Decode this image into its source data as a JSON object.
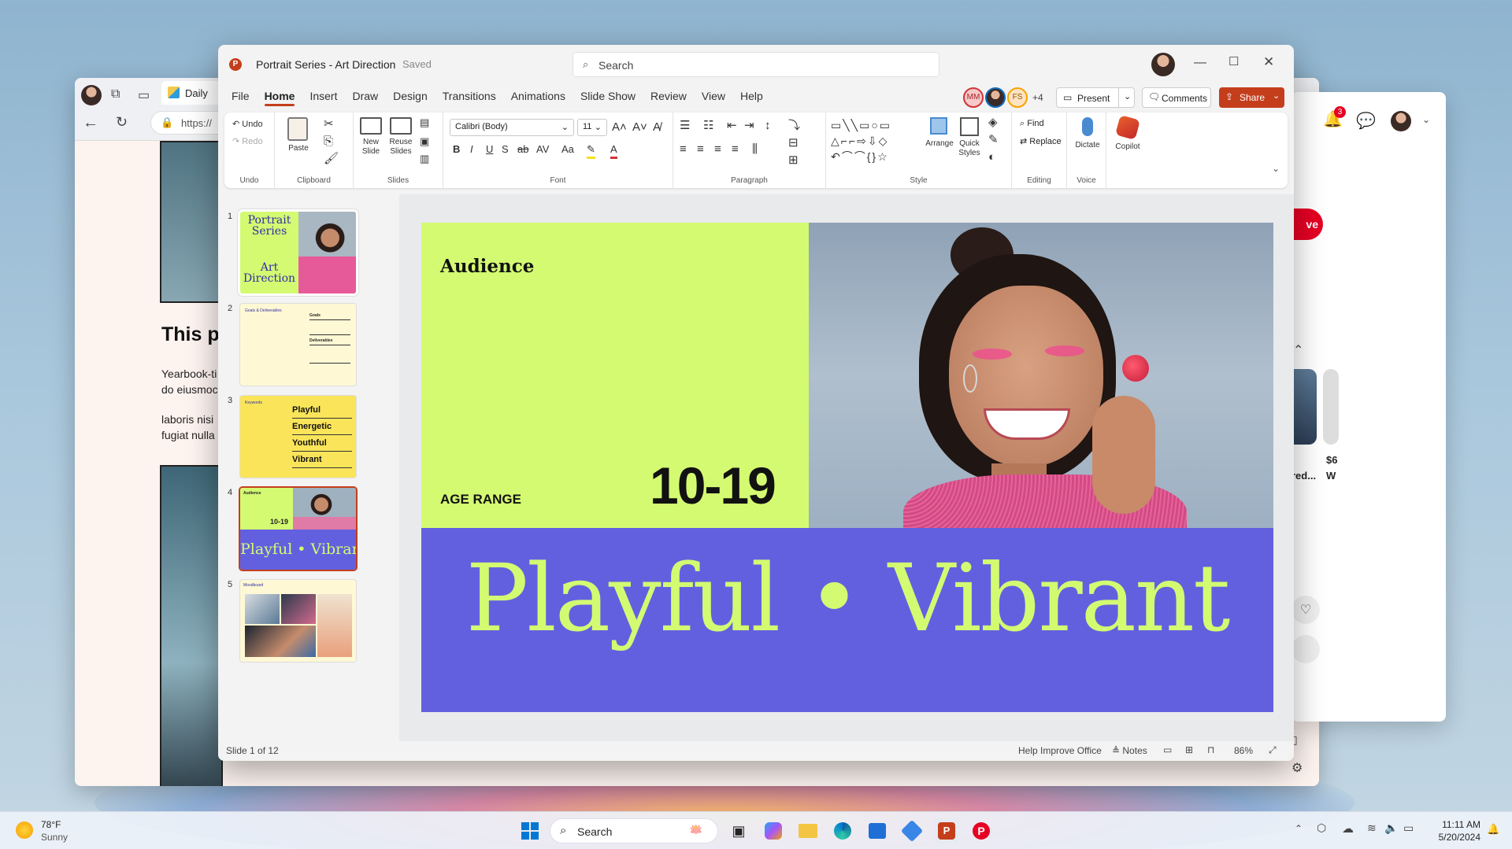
{
  "edge": {
    "tab_title": "Daily",
    "url": "https://",
    "heading": "This p",
    "para1_line1": "Yearbook-ti",
    "para1_line2": "do eiusmoc",
    "para2_line1": "laboris nisi",
    "para2_line2": "fugiat nulla"
  },
  "pinterest": {
    "save_label": "ve",
    "notif_count": "3",
    "price": "$6",
    "caption1": "red...",
    "caption2": "W"
  },
  "ppt": {
    "title": "Portrait Series - Art Direction",
    "saved": "Saved",
    "search_placeholder": "Search",
    "menu": [
      "File",
      "Home",
      "Insert",
      "Draw",
      "Design",
      "Transitions",
      "Animations",
      "Slide Show",
      "Review",
      "View",
      "Help"
    ],
    "collab": {
      "initials1": "MM",
      "initials3": "FS",
      "more": "+4"
    },
    "present": "Present",
    "comments": "Comments",
    "share": "Share",
    "ribbon": {
      "undo": "Undo",
      "redo": "Redo",
      "undo_group": "Undo",
      "paste": "Paste",
      "clipboard_group": "Clipboard",
      "new_slide": "New Slide",
      "reuse_slides": "Reuse Slides",
      "slides_group": "Slides",
      "font_name": "Calibri (Body)",
      "font_size": "11",
      "font_group": "Font",
      "paragraph_group": "Paragraph",
      "arrange": "Arrange",
      "quick_styles": "Quick Styles",
      "style_group": "Style",
      "find": "Find",
      "replace": "Replace",
      "editing_group": "Editing",
      "dictate": "Dictate",
      "voice_group": "Voice",
      "copilot": "Copilot"
    },
    "thumbnails": [
      {
        "num": "1",
        "t1": "Portrait",
        "t2": "Series",
        "t3": "Art",
        "t4": "Direction"
      },
      {
        "num": "2",
        "t1": "Goals & Deliverables",
        "t2": "Goals",
        "t3": "Deliverables"
      },
      {
        "num": "3",
        "t1": "Keywords",
        "items": [
          "Playful",
          "Energetic",
          "Youthful",
          "Vibrant"
        ]
      },
      {
        "num": "4",
        "t1": "Audience",
        "t2": "10-19",
        "t3": "Playful • Vibrant"
      },
      {
        "num": "5",
        "t1": "Moodboard"
      }
    ],
    "slide": {
      "heading": "Audience",
      "age_label": "AGE RANGE",
      "age_value": "10-19",
      "tagline": "Playful • Vibrant"
    },
    "status": {
      "slide_info": "Slide 1 of 12",
      "help": "Help Improve Office",
      "notes": "Notes",
      "zoom": "86%"
    }
  },
  "taskbar": {
    "temp": "78°F",
    "weather": "Sunny",
    "search": "Search",
    "time": "11:11 AM",
    "date": "5/20/2024"
  },
  "colors": {
    "accent": "#c43e1c",
    "lime": "#d4fa72",
    "violet": "#6360df",
    "navy": "#2f2ea6"
  }
}
